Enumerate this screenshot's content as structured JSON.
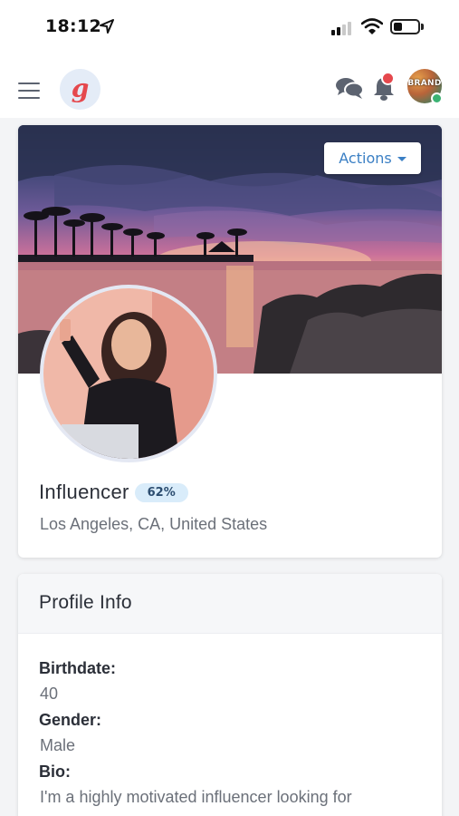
{
  "status_bar": {
    "time": "18:12",
    "battery_level": 0.35,
    "signal_bars_active": 2
  },
  "navbar": {
    "menu_icon": "hamburger-menu-icon",
    "logo_letter": "g",
    "chat_icon": "chat-bubbles-icon",
    "notification_icon": "bell-icon",
    "avatar_text": "BRAND",
    "colors": {
      "logo_bg": "#e4ecf7",
      "logo_letter": "#e5484d",
      "badge_red": "#e5484d",
      "online_green": "#3bb273"
    }
  },
  "profile": {
    "actions_label": "Actions",
    "name": "Influencer",
    "completion_badge": "62%",
    "location": "Los Angeles, CA, United States"
  },
  "profile_info": {
    "title": "Profile Info",
    "fields": [
      {
        "label": "Birthdate:",
        "value": "40"
      },
      {
        "label": "Gender:",
        "value": "Male"
      },
      {
        "label": "Bio:",
        "value": "I'm a highly motivated influencer looking for"
      }
    ]
  },
  "colors": {
    "page_bg": "#f3f4f6",
    "card_bg": "#ffffff",
    "accent_blue": "#3a7fc4",
    "badge_bg": "#d9ecfa"
  }
}
